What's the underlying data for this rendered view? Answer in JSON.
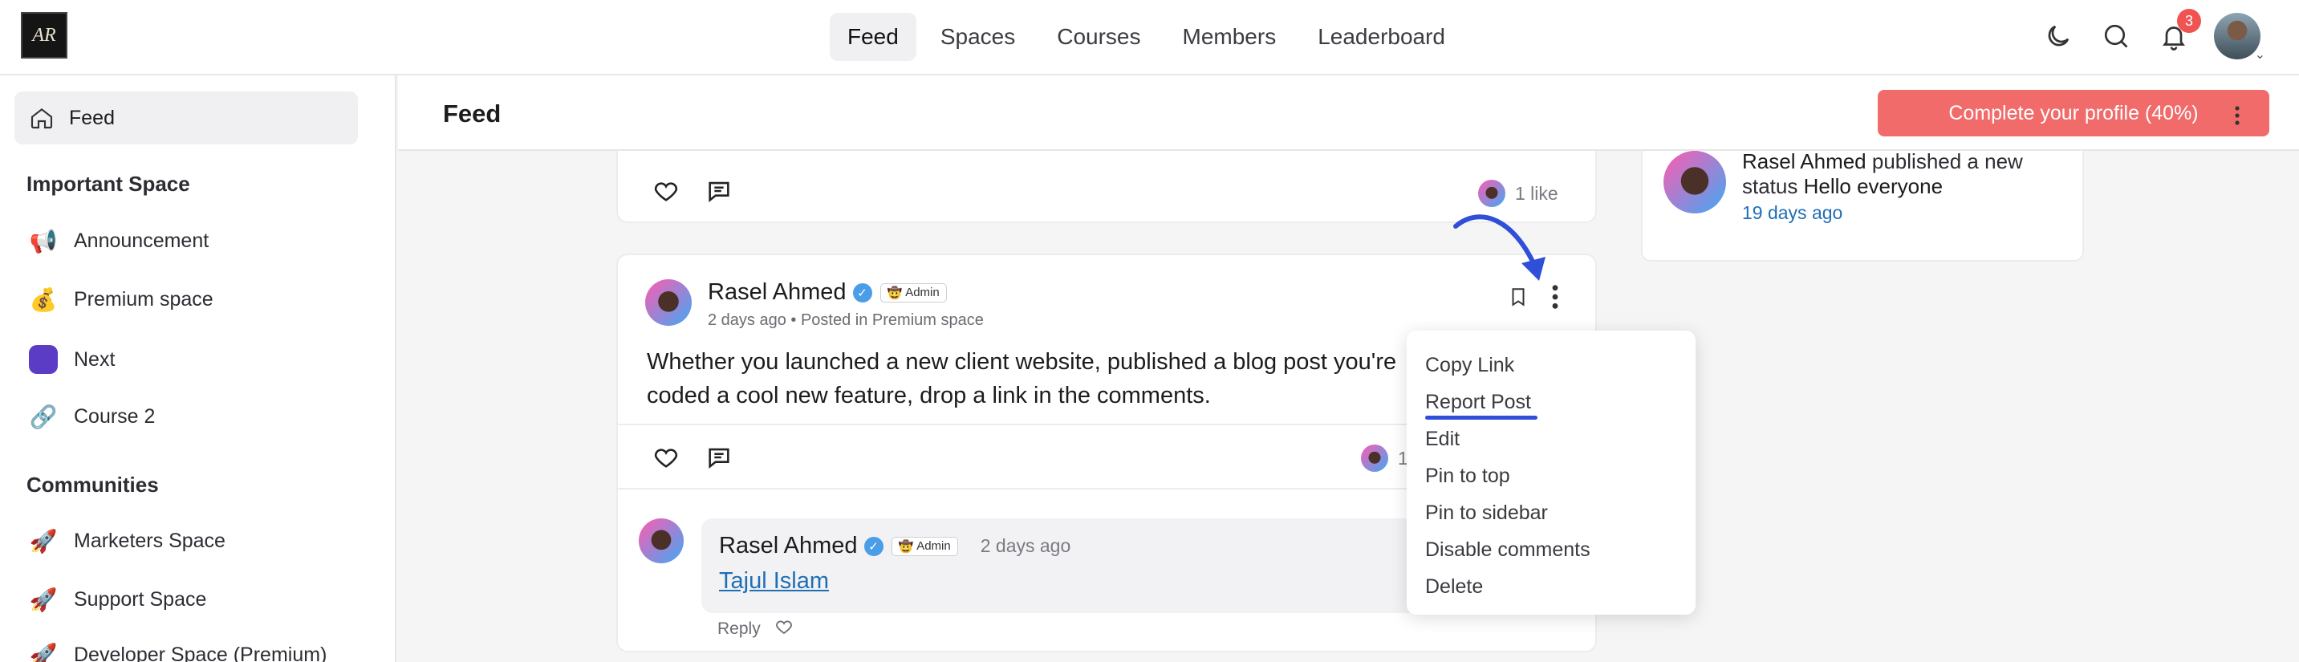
{
  "topbar": {
    "logo_text": "AR",
    "nav": [
      "Feed",
      "Spaces",
      "Courses",
      "Members",
      "Leaderboard"
    ],
    "notification_count": "3"
  },
  "sidebar": {
    "feed_label": "Feed",
    "important_heading": "Important Space",
    "important_items": [
      {
        "label": "Announcement",
        "icon": "megaphone-icon"
      },
      {
        "label": "Premium space",
        "icon": "money-bag-icon"
      },
      {
        "label": "Next",
        "icon": "purple-square-icon"
      },
      {
        "label": "Course 2",
        "icon": "link-icon"
      }
    ],
    "communities_heading": "Communities",
    "community_items": [
      {
        "label": "Marketers Space",
        "icon": "rocket-icon"
      },
      {
        "label": "Support Space",
        "icon": "rocket-icon"
      },
      {
        "label": "Developer Space (Premium)",
        "icon": "rocket-icon"
      }
    ]
  },
  "header": {
    "title": "Feed",
    "profile_button": "Complete your profile (40%)"
  },
  "post1": {
    "likes": "1 like"
  },
  "post2": {
    "author": "Rasel Ahmed",
    "badge": "Admin",
    "meta": "2 days ago • Posted in Premium space",
    "body_line1": "Whether you launched a new client website, published a blog post you're",
    "body_line2": "coded a cool new feature, drop a link in the comments.",
    "likes": "1"
  },
  "comment": {
    "author": "Rasel Ahmed",
    "badge": "Admin",
    "time": "2 days ago",
    "link": "Tajul Islam",
    "reply": "Reply"
  },
  "menu": [
    "Copy Link",
    "Report Post",
    "Edit",
    "Pin to top",
    "Pin to sidebar",
    "Disable comments",
    "Delete"
  ],
  "activity": {
    "author": "Rasel Ahmed",
    "action": "published a new",
    "status_label": "status",
    "status_text": "Hello everyone",
    "time": "19 days ago"
  },
  "colors": {
    "accent_red": "#f26b6b",
    "annotation_blue": "#2f4fd8",
    "link_blue": "#1f6fb5"
  }
}
